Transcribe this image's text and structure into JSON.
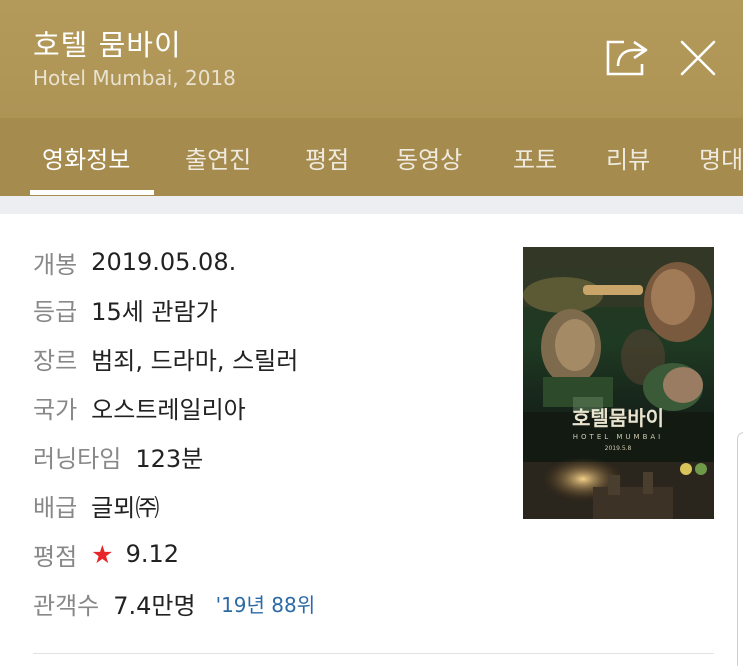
{
  "header": {
    "title": "호텔 뭄바이",
    "subtitle": "Hotel Mumbai, 2018",
    "share_icon": "share-icon",
    "close_icon": "close-icon"
  },
  "tabs": [
    {
      "label": "영화정보",
      "active": true
    },
    {
      "label": "출연진"
    },
    {
      "label": "평점"
    },
    {
      "label": "동영상"
    },
    {
      "label": "포토"
    },
    {
      "label": "리뷰"
    },
    {
      "label": "명대"
    }
  ],
  "info": {
    "release": {
      "label": "개봉",
      "value": "2019.05.08."
    },
    "rating": {
      "label": "등급",
      "value": "15세 관람가"
    },
    "genre": {
      "label": "장르",
      "value": "범죄, 드라마, 스릴러"
    },
    "country": {
      "label": "국가",
      "value": "오스트레일리아"
    },
    "runtime": {
      "label": "러닝타임",
      "value": "123분"
    },
    "distributor": {
      "label": "배급",
      "value": "글뫼㈜"
    },
    "score": {
      "label": "평점",
      "star": "★",
      "value": "9.12"
    },
    "audience": {
      "label": "관객수",
      "value": "7.4만명",
      "rank": "'19년 88위"
    }
  },
  "poster": {
    "title": "호텔뭄바이",
    "subtitle": "HOTEL MUMBAI",
    "date": "2019.5.8"
  },
  "colors": {
    "header_bg": "#b49a5a",
    "tabs_bg": "#a58b4d",
    "star": "#e8262a",
    "rank_link": "#2c6aa6"
  }
}
